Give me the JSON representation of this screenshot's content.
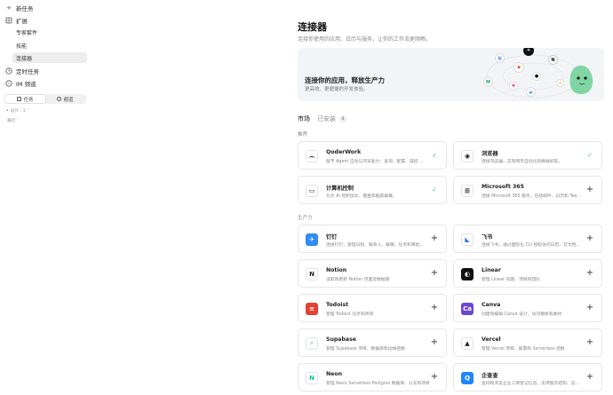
{
  "sidebar": {
    "new_task": "新任务",
    "extensions": "扩展",
    "sub_items": [
      {
        "label": "专家套件",
        "active": false
      },
      {
        "label": "技能",
        "active": false
      },
      {
        "label": "连接器",
        "active": true
      }
    ],
    "scheduled": "定时任务",
    "im": "IM 频道",
    "toggle": {
      "left": "任务",
      "right": "频道"
    },
    "ghost_line1": "设计 · 1 ˅",
    "ghost_line2": "最近 ˅"
  },
  "header": {
    "title": "连接器",
    "subtitle": "连接你使用的应用、日历与服务，让你的工作流更顺畅。"
  },
  "hero": {
    "heading": "连接你的应用，释放生产力",
    "sub": "更高效、更便捷的开发体验。"
  },
  "tabs": {
    "market": "市场",
    "installed": "已安装",
    "installed_count": "4"
  },
  "sections": {
    "recommended": "推荐",
    "productivity": "生产力"
  },
  "recommended": [
    {
      "name": "QoderWork",
      "desc": "赋予 Agent 自动与浏览能力：查询、配置、操控 ...",
      "action": "check",
      "icon": "qoder-icon",
      "color": "#ffffff",
      "glyph": "෴"
    },
    {
      "name": "浏览器",
      "desc": "连接浏览器，实现网页自动化和数据抓取。",
      "action": "check",
      "icon": "browser-icon",
      "color": "#ffffff",
      "glyph": "◉"
    },
    {
      "name": "计算机控制",
      "desc": "允许 AI 控制鼠标、键盘和截取屏幕。",
      "action": "check",
      "icon": "monitor-icon",
      "color": "#ffffff",
      "glyph": "▭"
    },
    {
      "name": "Microsoft 365",
      "desc": "连接 Microsoft 365 服务，包括邮件、日历和 Tea...",
      "action": "add",
      "icon": "grid-icon",
      "color": "#ffffff",
      "glyph": "⊞"
    }
  ],
  "productivity": [
    {
      "name": "钉钉",
      "desc": "连接钉钉，管理日程、联系人、群聊、任务和审批...",
      "action": "add",
      "icon": "dingtalk-icon",
      "color": "#2f8cf2",
      "glyph": "✈"
    },
    {
      "name": "飞书",
      "desc": "连接飞书，通过国际化 CLI 授权访问日历、云文档...",
      "action": "add",
      "icon": "feishu-icon",
      "color": "#ffffff",
      "glyph": "◣"
    },
    {
      "name": "Notion",
      "desc": "读取和更新 Notion 页面及数据库",
      "action": "add",
      "icon": "notion-icon",
      "color": "#ffffff",
      "glyph": "N"
    },
    {
      "name": "Linear",
      "desc": "管理 Linear 问题、项目和团队",
      "action": "add",
      "icon": "linear-icon",
      "color": "#111111",
      "glyph": "◐"
    },
    {
      "name": "Todoist",
      "desc": "管理 Todoist 任务和项目",
      "action": "add",
      "icon": "todoist-icon",
      "color": "#e44332",
      "glyph": "≡"
    },
    {
      "name": "Canva",
      "desc": "创建和编辑 Canva 设计，访问模板和素材",
      "action": "add",
      "icon": "canva-icon",
      "color": "#6c47d6",
      "glyph": "Ca"
    },
    {
      "name": "Supabase",
      "desc": "管理 Supabase 项目、数据库和边缘函数",
      "action": "add",
      "icon": "supabase-icon",
      "color": "#ffffff",
      "glyph": "⚡"
    },
    {
      "name": "Vercel",
      "desc": "管理 Vercel 项目、部署和 Serverless 函数",
      "action": "add",
      "icon": "vercel-icon",
      "color": "#ffffff",
      "glyph": "▲"
    },
    {
      "name": "Neon",
      "desc": "管理 Neon Serverless Postgres 数据库、分支和项目",
      "action": "add",
      "icon": "neon-icon",
      "color": "#ffffff",
      "glyph": "N"
    },
    {
      "name": "企查查",
      "desc": "查询和浏览企业工商登记信息，支持股东结构、实...",
      "action": "add",
      "icon": "qichacha-icon",
      "color": "#1f86ff",
      "glyph": "Q"
    }
  ]
}
